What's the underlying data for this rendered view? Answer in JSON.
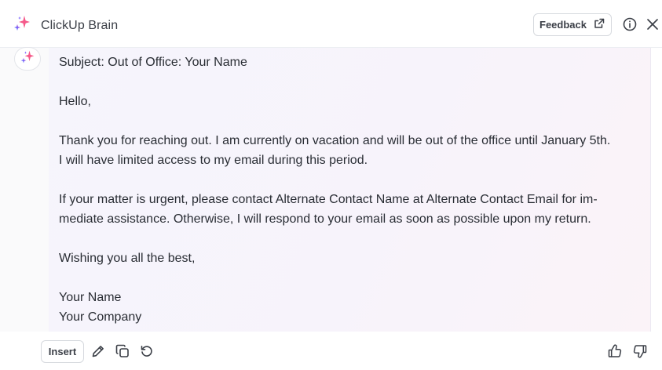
{
  "header": {
    "title": "ClickUp Brain",
    "feedback_label": "Feedback"
  },
  "icons": {
    "brand": "sparkle-icon",
    "feedback": "external-link-icon",
    "info": "info-icon",
    "close": "close-icon",
    "avatar": "sparkle-icon",
    "edit": "pencil-icon",
    "copy": "copy-icon",
    "regenerate": "refresh-icon",
    "like": "thumbs-up-icon",
    "dislike": "thumbs-down-icon"
  },
  "colors": {
    "sparkle_pink": "#f55a8a",
    "sparkle_purple": "#7b61ff",
    "sparkle_blue": "#4b9bf2"
  },
  "message": {
    "subject": "Subject: Out of Office: Your Name",
    "greeting": "Hello,",
    "para1_line1": "Thank you for reaching out. I am currently on vacation and will be out of the office until January 5th.",
    "para1_line2": "I will have limited access to my email during this period.",
    "para2_line1": "If your matter is urgent, please contact Alternate Contact Name at Alternate Contact Email for im-",
    "para2_line2": "mediate assistance. Otherwise, I will respond to your email as soon as possible upon my return.",
    "closing": "Wishing you all the best,",
    "sign_name": "Your Name",
    "sign_company": "Your Company"
  },
  "footer": {
    "insert_label": "Insert"
  }
}
